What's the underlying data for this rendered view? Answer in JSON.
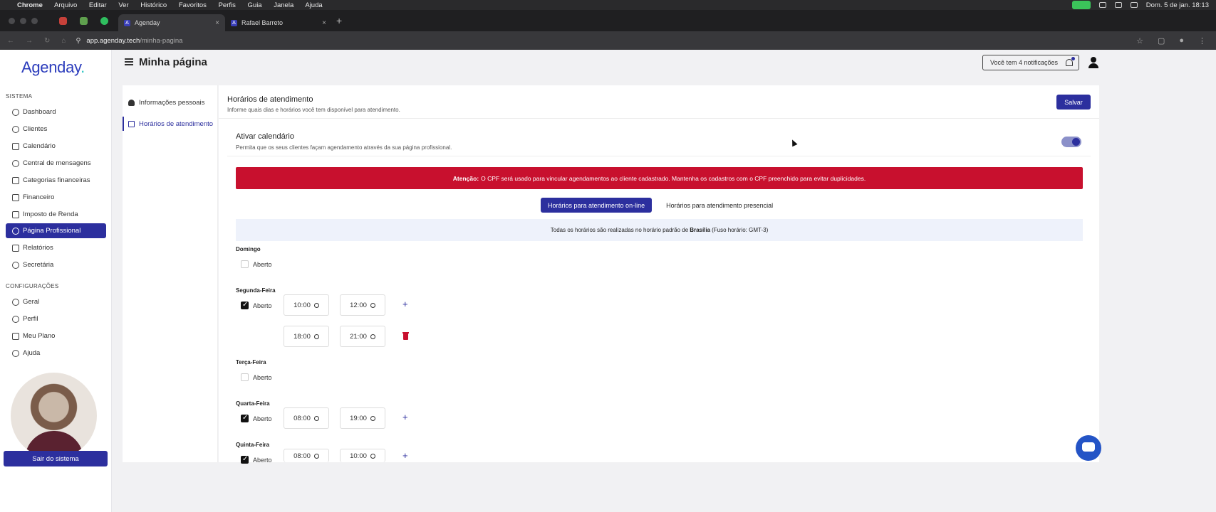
{
  "macos": {
    "app": "Chrome",
    "menus": [
      "Arquivo",
      "Editar",
      "Ver",
      "Histórico",
      "Favoritos",
      "Perfis",
      "Guia",
      "Janela",
      "Ajuda"
    ],
    "datetime": "Dom. 5 de jan.  18:13"
  },
  "browser": {
    "tabs": [
      {
        "label": "Agenday",
        "active": true
      },
      {
        "label": "Rafael Barreto",
        "active": false
      }
    ],
    "url_host": "app.agenday.tech",
    "url_path": "/minha-pagina"
  },
  "brand": {
    "logo_text": "Agenday",
    "logo_dot": ".",
    "accent": "#2c2f9e",
    "alert_color": "#c8102e"
  },
  "sidebar": {
    "section_system": "SISTEMA",
    "system_items": [
      {
        "label": "Dashboard",
        "icon": "dashboard-icon"
      },
      {
        "label": "Clientes",
        "icon": "users-icon"
      },
      {
        "label": "Calendário",
        "icon": "calendar-icon"
      },
      {
        "label": "Central de mensagens",
        "icon": "messages-icon"
      },
      {
        "label": "Categorias financeiras",
        "icon": "categories-icon"
      },
      {
        "label": "Financeiro",
        "icon": "finance-icon"
      },
      {
        "label": "Imposto de Renda",
        "icon": "tax-icon"
      },
      {
        "label": "Página Profissional",
        "icon": "globe-icon",
        "active": true
      },
      {
        "label": "Relatórios",
        "icon": "reports-icon"
      },
      {
        "label": "Secretária",
        "icon": "secretary-icon"
      }
    ],
    "section_config": "CONFIGURAÇÕES",
    "config_items": [
      {
        "label": "Geral",
        "icon": "settings-icon"
      },
      {
        "label": "Perfil",
        "icon": "profile-icon"
      },
      {
        "label": "Meu Plano",
        "icon": "plan-icon"
      },
      {
        "label": "Ajuda",
        "icon": "help-icon"
      }
    ],
    "logout_label": "Sair do sistema"
  },
  "header": {
    "title": "Minha página",
    "notifications_label": "Você tem 4 notificações"
  },
  "subnav": {
    "items": [
      {
        "label": "Informações pessoais"
      },
      {
        "label": "Horários de atendimento",
        "active": true
      }
    ]
  },
  "main": {
    "title": "Horários de atendimento",
    "subtitle": "Informe quais dias e horários você tem disponível para atendimento.",
    "save_label": "Salvar",
    "calendar_title": "Ativar calendário",
    "calendar_subtitle": "Permita que os seus clientes façam agendamento através da sua página profissional.",
    "calendar_enabled": true,
    "alert_strong": "Atenção:",
    "alert_text": "O CPF será usado para vincular agendamentos ao cliente cadastrado. Mantenha os cadastros com o CPF preenchido para evitar duplicidades.",
    "tab_online": "Horários para atendimento on-line",
    "tab_presencial": "Horários para atendimento presencial",
    "tz_prefix": "Todas os horários são realizadas no horário padrão de",
    "tz_city": "Brasília",
    "tz_suffix": "(Fuso horário: GMT-3)",
    "open_label": "Aberto",
    "days": [
      {
        "name": "Domingo",
        "open": false
      },
      {
        "name": "Segunda-Feira",
        "open": true,
        "slots": [
          [
            "10:00",
            "12:00"
          ],
          [
            "18:00",
            "21:00"
          ]
        ]
      },
      {
        "name": "Terça-Feira",
        "open": false
      },
      {
        "name": "Quarta-Feira",
        "open": true,
        "slots": [
          [
            "08:00",
            "19:00"
          ]
        ]
      },
      {
        "name": "Quinta-Feira",
        "open": true,
        "slots": [
          [
            "08:00",
            "10:00"
          ]
        ]
      }
    ]
  }
}
